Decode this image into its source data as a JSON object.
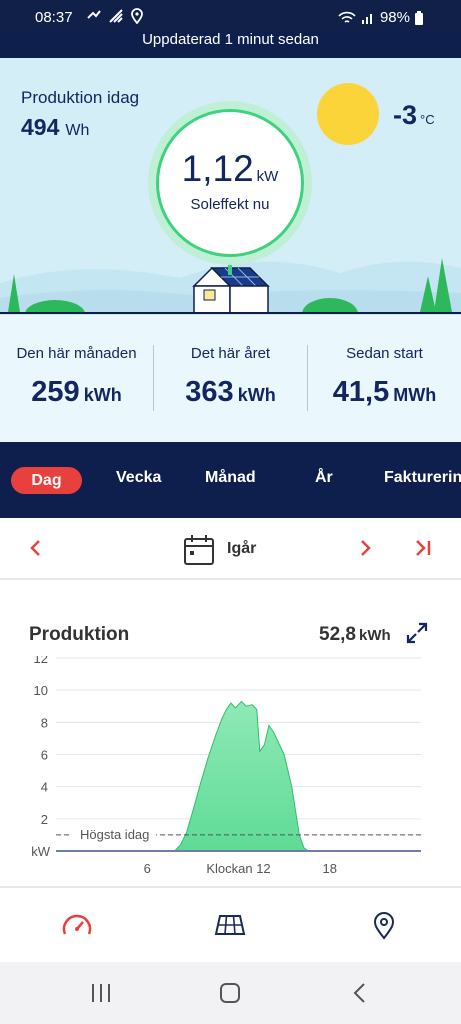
{
  "status_bar": {
    "time": "08:37",
    "battery": "98%"
  },
  "header": {
    "updated": "Uppdaterad 1 minut sedan"
  },
  "hero": {
    "production_today_label": "Produktion idag",
    "production_today_value": "494",
    "production_today_unit": "Wh",
    "temperature_value": "-3",
    "temperature_unit": "°C",
    "current_power_value": "1,12",
    "current_power_unit": "kW",
    "current_power_caption": "Soleffekt nu"
  },
  "totals": [
    {
      "label": "Den här månaden",
      "value": "259",
      "unit": "kWh"
    },
    {
      "label": "Det här året",
      "value": "363",
      "unit": "kWh"
    },
    {
      "label": "Sedan start",
      "value": "41,5",
      "unit": "MWh"
    }
  ],
  "tabs": [
    {
      "label": "Dag",
      "active": true
    },
    {
      "label": "Vecka",
      "active": false
    },
    {
      "label": "Månad",
      "active": false
    },
    {
      "label": "År",
      "active": false
    },
    {
      "label": "Fakturering",
      "active": false
    }
  ],
  "date_nav": {
    "label": "Igår"
  },
  "chart_card": {
    "title": "Produktion",
    "total_value": "52,8",
    "total_unit": "kWh"
  },
  "chart_data": {
    "type": "area",
    "title": "Produktion",
    "ylabel": "kW",
    "xlabel": "Klockan 12",
    "ylim": [
      0,
      12
    ],
    "y_ticks": [
      "2",
      "4",
      "6",
      "8",
      "10",
      "12"
    ],
    "x_ticks": [
      {
        "x": 6,
        "label": "6"
      },
      {
        "x": 12,
        "label": "Klockan 12"
      },
      {
        "x": 18,
        "label": "18"
      }
    ],
    "xlim": [
      0,
      24
    ],
    "reference_line": {
      "label": "Högsta idag",
      "value": 1.0
    },
    "series": [
      {
        "x": [
          7.0,
          7.8,
          8.2,
          8.6,
          9.0,
          9.5,
          10.0,
          10.5,
          10.9,
          11.2,
          11.5,
          11.8,
          12.2,
          12.5,
          12.9,
          13.2,
          13.4,
          13.7,
          14.0,
          14.3,
          14.6,
          15.0,
          15.5,
          16.0,
          16.3,
          16.6,
          17.0
        ],
        "y": [
          0.0,
          0.0,
          0.4,
          1.2,
          2.5,
          4.2,
          5.8,
          7.2,
          8.2,
          8.8,
          9.2,
          8.9,
          9.3,
          9.0,
          9.1,
          8.8,
          6.2,
          6.6,
          7.8,
          7.4,
          6.8,
          6.0,
          4.0,
          1.0,
          0.2,
          0.0,
          0.0
        ]
      }
    ],
    "colors": {
      "fill": "#5fdb96",
      "fill_top": "#8fe9b6",
      "stroke": "#2fbf6a",
      "grid": "#e3e6ea",
      "reference": "#555555"
    }
  },
  "bottom_nav": [
    {
      "icon": "speedometer-icon",
      "active": true
    },
    {
      "icon": "solar-panel-icon",
      "active": false
    },
    {
      "icon": "location-pin-icon",
      "active": false
    }
  ],
  "colors": {
    "navy": "#0e1f4e",
    "accent": "#e8413d",
    "sky": "#d4eef8",
    "sun": "#fbd43a",
    "gauge_ring": "#3fd27e"
  }
}
